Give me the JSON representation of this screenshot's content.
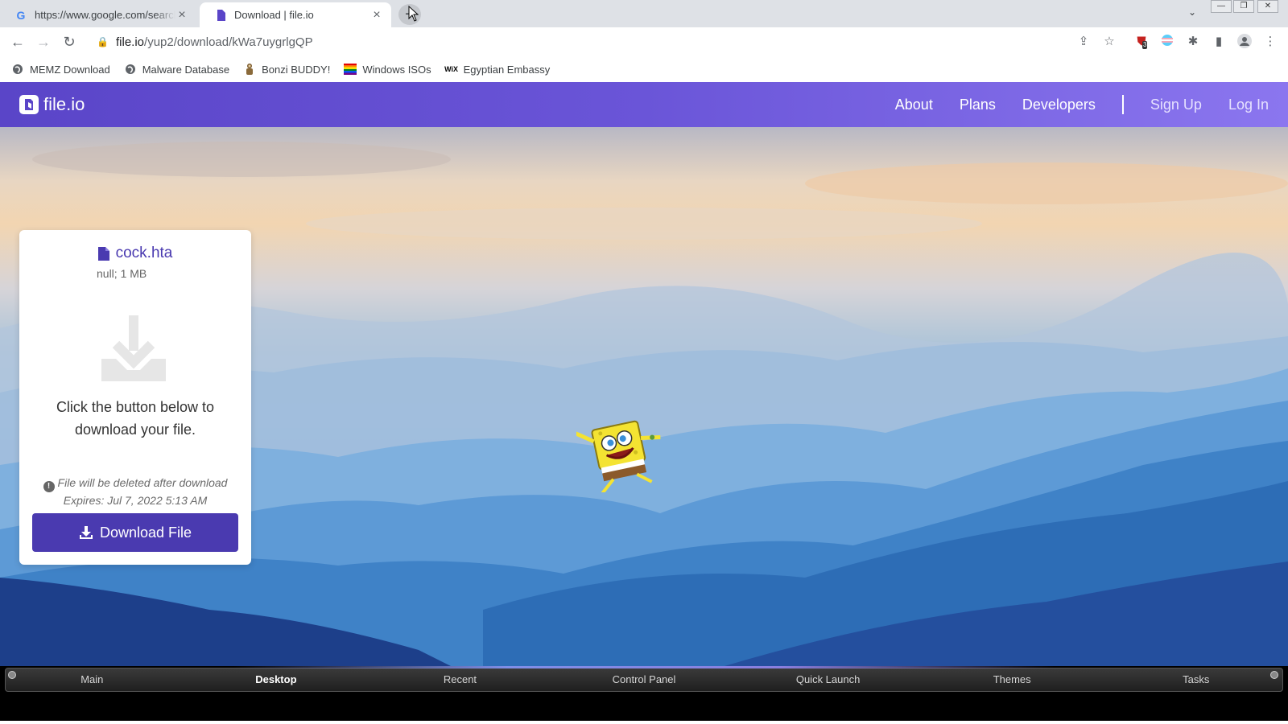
{
  "browser": {
    "tabs": [
      {
        "title": "https://www.google.com/search",
        "favicon": "G",
        "active": false
      },
      {
        "title": "Download | file.io",
        "favicon": "file-io-logo",
        "active": true
      }
    ],
    "new_tab_symbol": "+",
    "tab_menu_symbol": "⌄",
    "url_host": "file.io",
    "url_path": "/yup2/download/kWa7uygrlgQP",
    "extension_badge": "3",
    "window_buttons": [
      "—",
      "❐",
      "✕"
    ]
  },
  "bookmarks": [
    {
      "label": "MEMZ Download",
      "icon": "globe-icon"
    },
    {
      "label": "Malware Database",
      "icon": "globe-icon"
    },
    {
      "label": "Bonzi BUDDY!",
      "icon": "bonzi-icon"
    },
    {
      "label": "Windows ISOs",
      "icon": "windows-flag-icon"
    },
    {
      "label": "Egyptian Embassy",
      "icon": "wix-icon"
    }
  ],
  "site": {
    "brand": "file.io",
    "nav": [
      "About",
      "Plans",
      "Developers"
    ],
    "auth": [
      "Sign Up",
      "Log In"
    ]
  },
  "card": {
    "file_name": "cock.hta",
    "file_meta": "null; 1 MB",
    "instruction": "Click the button below to download your file.",
    "notice_line1": "File will be deleted after download",
    "notice_line2": "Expires: Jul 7, 2022 5:13 AM",
    "button_label": "Download File"
  },
  "taskbar": {
    "items": [
      "Main",
      "Desktop",
      "Recent",
      "Control Panel",
      "Quick Launch",
      "Themes",
      "Tasks"
    ],
    "current": "Desktop"
  },
  "colors": {
    "brand_purple": "#4a3ab0",
    "header_gradient_start": "#5a45c8",
    "header_gradient_end": "#8b76ef"
  }
}
